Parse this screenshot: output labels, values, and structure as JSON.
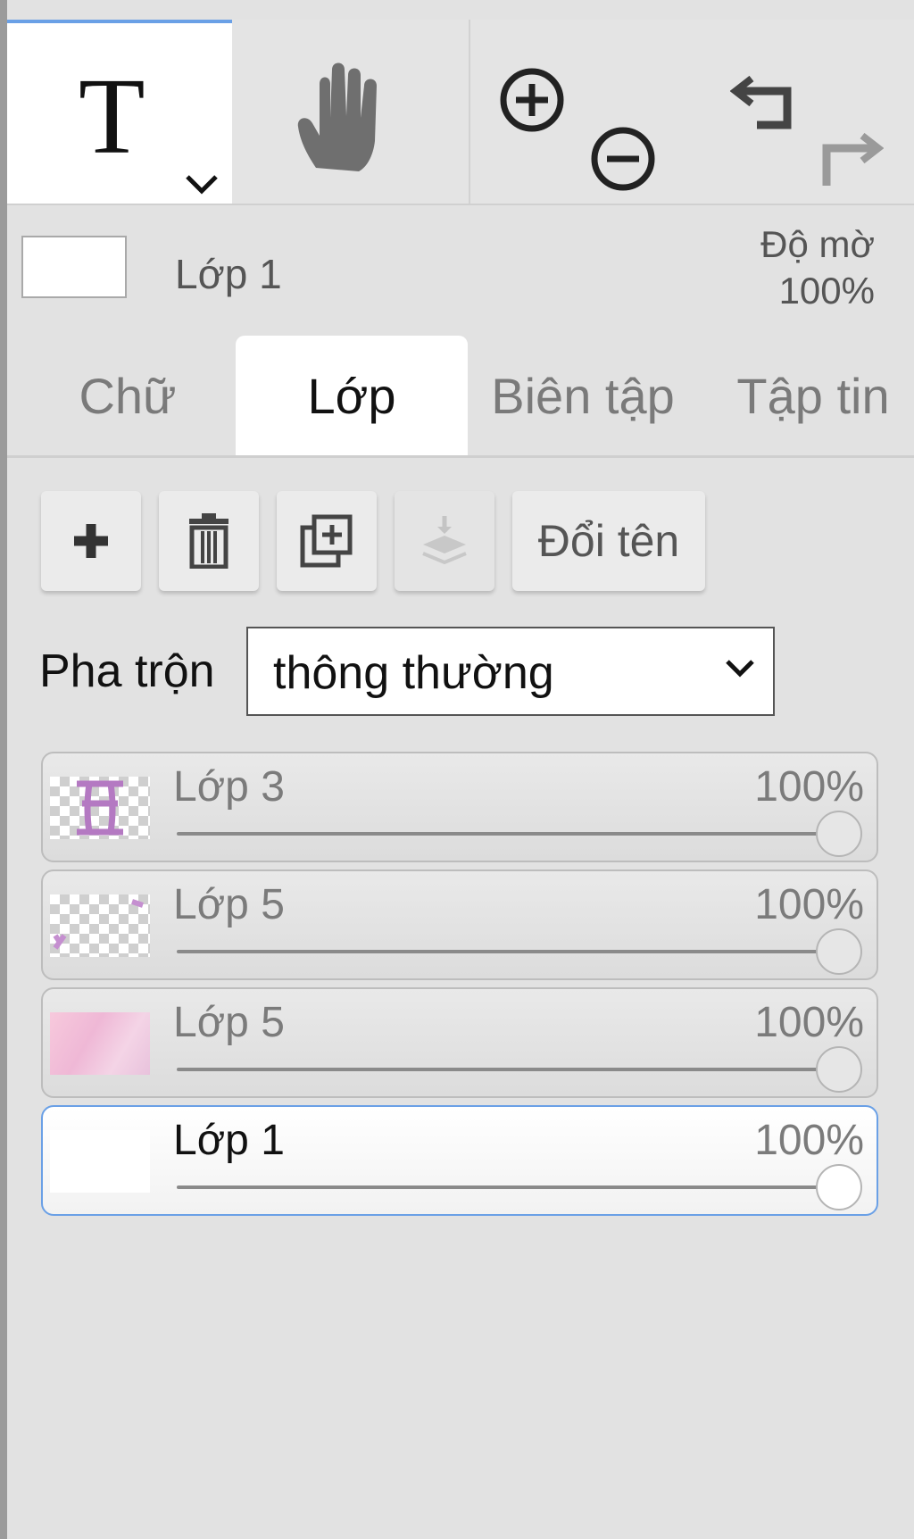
{
  "toolbar": {
    "text_tool": "T",
    "tools": [
      "text-tool",
      "hand-tool",
      "zoom-in",
      "zoom-out",
      "undo",
      "redo"
    ]
  },
  "layer_info": {
    "name": "Lớp 1",
    "opacity_label": "Độ mờ",
    "opacity_value": "100%"
  },
  "tabs": [
    {
      "label": "Chữ",
      "active": false
    },
    {
      "label": "Lớp",
      "active": true
    },
    {
      "label": "Biên tập",
      "active": false
    },
    {
      "label": "Tập tin",
      "active": false
    }
  ],
  "actions": {
    "add_icon": "plus-icon",
    "delete_icon": "trash-icon",
    "duplicate_icon": "duplicate-icon",
    "merge_icon": "merge-down-icon",
    "rename_label": "Đổi tên"
  },
  "blend": {
    "label": "Pha trộn",
    "value": "thông thường"
  },
  "layers": [
    {
      "name": "Lớp 3",
      "opacity": "100%",
      "opacity_fraction": 1.0,
      "selected": false
    },
    {
      "name": "Lớp 5",
      "opacity": "100%",
      "opacity_fraction": 1.0,
      "selected": false
    },
    {
      "name": "Lớp 5",
      "opacity": "100%",
      "opacity_fraction": 1.0,
      "selected": false
    },
    {
      "name": "Lớp 1",
      "opacity": "100%",
      "opacity_fraction": 1.0,
      "selected": true
    }
  ],
  "colors": {
    "accent": "#6aa0e6",
    "panel_bg": "#e2e2e2"
  }
}
